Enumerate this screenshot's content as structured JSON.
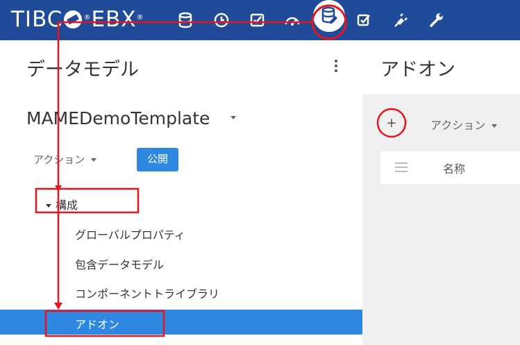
{
  "topbar": {
    "logo_text": "TIBC",
    "logo_text_2": "EBX",
    "logo_mark": "®",
    "icons": [
      "database-icon",
      "clock-icon",
      "checklist-icon",
      "gauge-icon",
      "data-model-icon",
      "task-check-icon",
      "plug-icon",
      "wrench-icon"
    ],
    "active_icon": "data-model-icon",
    "bg_color": "#1f4b99"
  },
  "left_panel": {
    "title": "データモデル",
    "model_name": "MAMEDemoTemplate",
    "action_label": "アクション",
    "publish_label": "公開",
    "tree": {
      "group_label": "構成",
      "items": [
        "グローバルプロパティ",
        "包含データモデル",
        "コンポーネントトライブラリ",
        "アドオン"
      ],
      "selected": "アドオン"
    }
  },
  "right_panel": {
    "title": "アドオン",
    "add_label": "+",
    "action_label": "アクション",
    "column_name": "名称"
  },
  "colors": {
    "accent": "#2e87e0",
    "annotation": "#e8141c"
  }
}
